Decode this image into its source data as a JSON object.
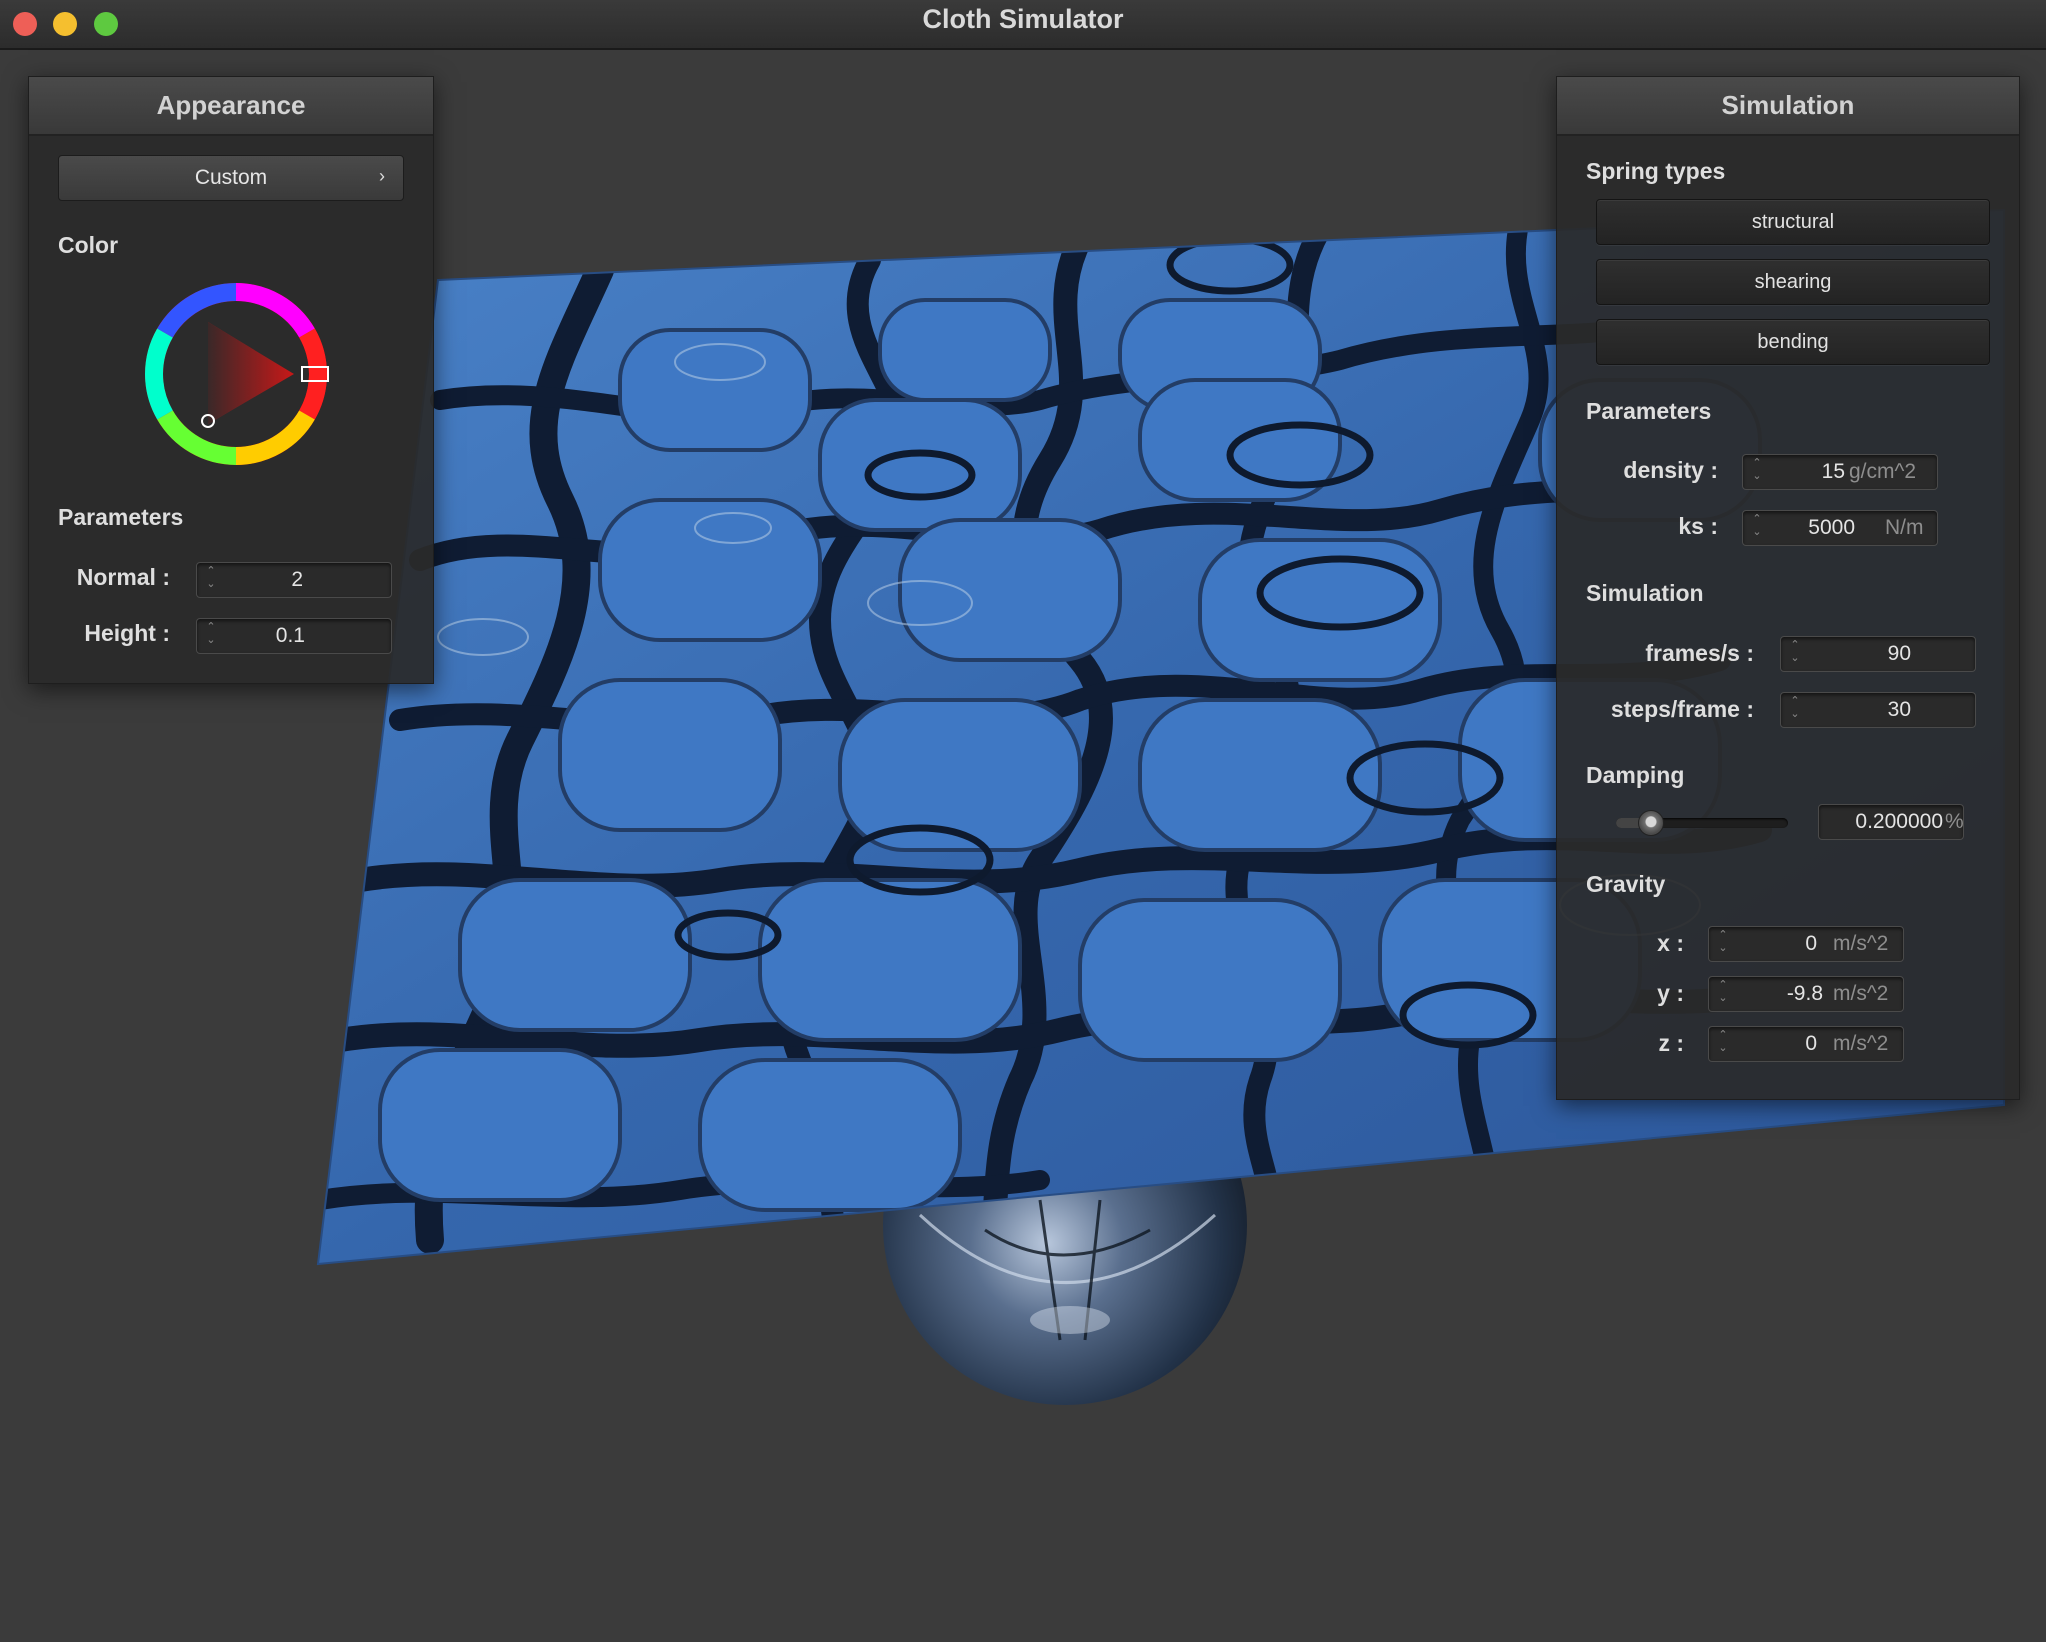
{
  "window": {
    "title": "Cloth Simulator"
  },
  "appearance": {
    "header": "Appearance",
    "preset_button": "Custom",
    "color_label": "Color",
    "color_hex": "#e01010",
    "parameters_label": "Parameters",
    "normal": {
      "label": "Normal :",
      "value": "2"
    },
    "height": {
      "label": "Height :",
      "value": "0.1"
    }
  },
  "simulation": {
    "header": "Simulation",
    "spring_types_label": "Spring types",
    "springs": {
      "structural": "structural",
      "shearing": "shearing",
      "bending": "bending"
    },
    "parameters_label": "Parameters",
    "density": {
      "label": "density :",
      "value": "15",
      "unit": "g/cm^2"
    },
    "ks": {
      "label": "ks :",
      "value": "5000",
      "unit": "N/m"
    },
    "sim_label": "Simulation",
    "fps": {
      "label": "frames/s :",
      "value": "90"
    },
    "steps": {
      "label": "steps/frame :",
      "value": "30"
    },
    "damping_label": "Damping",
    "damping": {
      "value": "0.200000",
      "unit": "%",
      "slider_fraction": 0.2
    },
    "gravity_label": "Gravity",
    "gx": {
      "label": "x :",
      "value": "0",
      "unit": "m/s^2"
    },
    "gy": {
      "label": "y :",
      "value": "-9.8",
      "unit": "m/s^2"
    },
    "gz": {
      "label": "z :",
      "value": "0",
      "unit": "m/s^2"
    }
  },
  "colors": {
    "cloth": "#3a6fb8",
    "background": "#3b3b3b"
  }
}
